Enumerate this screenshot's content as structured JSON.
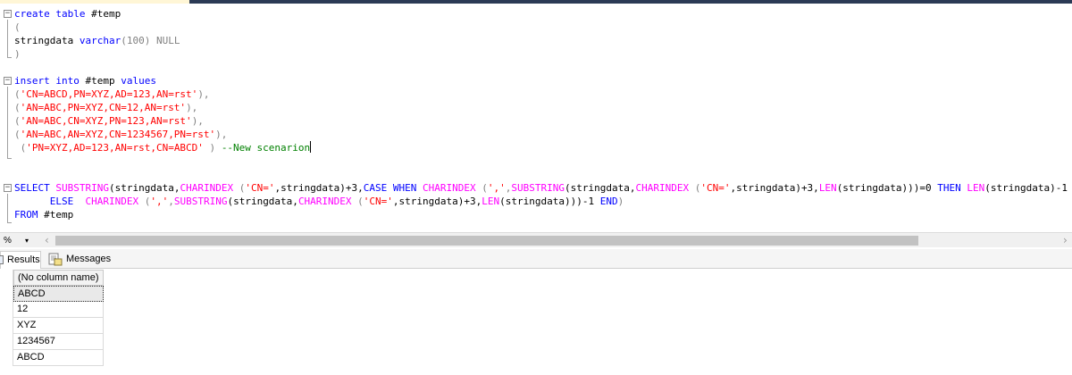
{
  "editor": {
    "lines": {
      "l1": {
        "kw": "create table",
        "rest": " #temp"
      },
      "l2": {
        "text": "("
      },
      "l3": {
        "name": "stringdata ",
        "type": "varchar",
        "size": "(100) ",
        "null": "NULL"
      },
      "l4": {
        "text": ")"
      },
      "l6": {
        "kw1": "insert into",
        "mid": " #temp ",
        "kw2": "values"
      },
      "l7": {
        "open": "(",
        "str": "'CN=ABCD,PN=XYZ,AD=123,AN=rst'",
        "close": "),"
      },
      "l8": {
        "open": "(",
        "str": "'AN=ABC,PN=XYZ,CN=12,AN=rst'",
        "close": "),"
      },
      "l9": {
        "open": "(",
        "str": "'AN=ABC,CN=XYZ,PN=123,AN=rst'",
        "close": "),"
      },
      "l10": {
        "open": "(",
        "str": "'AN=ABC,AN=XYZ,CN=1234567,PN=rst'",
        "close": "),"
      },
      "l11": {
        "open": " (",
        "str": "'PN=XYZ,AD=123,AN=rst,CN=ABCD'",
        "close": " ) ",
        "comment": "--New scenarion"
      },
      "l14": {
        "t1": "SELECT",
        "t2": " ",
        "t3": "SUBSTRING",
        "t4": "(stringdata,",
        "t5": "CHARINDEX",
        "t6": " (",
        "t7": "'CN='",
        "t8": ",stringdata)+3,",
        "t9": "CASE WHEN",
        "t10": " ",
        "t11": "CHARINDEX",
        "t12": " (",
        "t13": "','",
        "t14": ",",
        "t15": "SUBSTRING",
        "t16": "(stringdata,",
        "t17": "CHARINDEX",
        "t18": " (",
        "t19": "'CN='",
        "t20": ",stringdata)+3,",
        "t21": "LEN",
        "t22": "(stringdata)))=0 ",
        "t23": "THEN",
        "t24": " ",
        "t25": "LEN",
        "t26": "(stringdata)-1"
      },
      "l15": {
        "t1": "      ELSE",
        "t2": "  ",
        "t3": "CHARINDEX",
        "t4": " (",
        "t5": "','",
        "t6": ",",
        "t7": "SUBSTRING",
        "t8": "(stringdata,",
        "t9": "CHARINDEX",
        "t10": " (",
        "t11": "'CN='",
        "t12": ",stringdata)+3,",
        "t13": "LEN",
        "t14": "(stringdata)))-1 ",
        "t15": "END",
        "t16": ")"
      },
      "l16": {
        "kw": "FROM",
        "rest": " #temp"
      }
    }
  },
  "zoom": {
    "value": "%",
    "arrow": "▾"
  },
  "scroll": {
    "left": "‹",
    "right": "›"
  },
  "tabs": {
    "results": "Results",
    "messages": "Messages"
  },
  "grid": {
    "header": "(No column name)",
    "rows": [
      "ABCD",
      "12",
      "XYZ",
      "1234567",
      "ABCD"
    ]
  },
  "colors": {
    "keyword": "#0000ff",
    "function": "#ff00ff",
    "string": "#ff0000",
    "comment": "#008000",
    "null": "#808080"
  }
}
